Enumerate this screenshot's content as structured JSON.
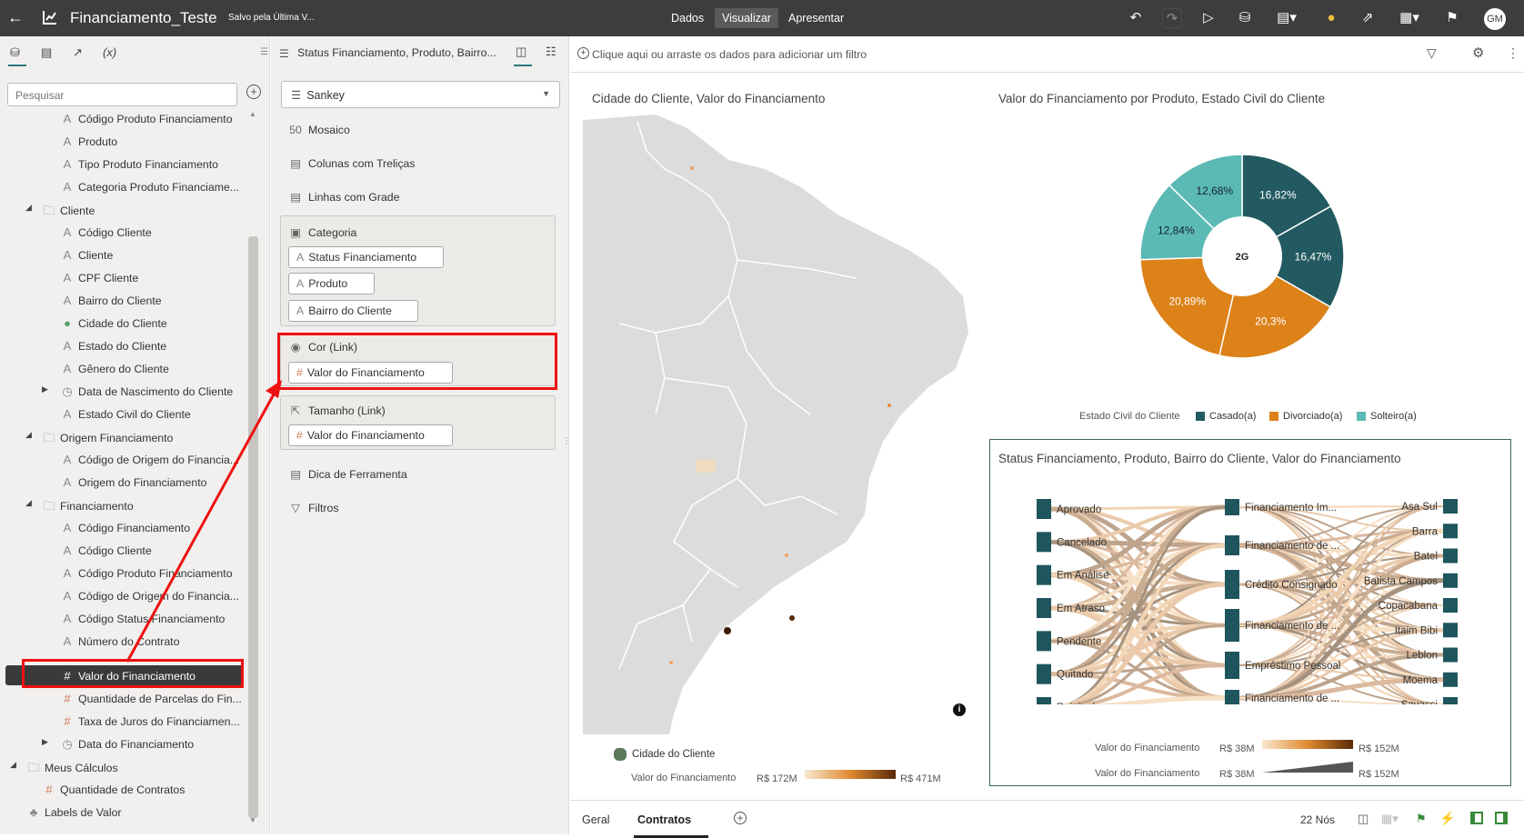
{
  "header": {
    "back_icon": "arrow-left-icon",
    "title": "Financiamento_Teste",
    "saved_status": "Salvo pela Última V...",
    "tabs": [
      "Dados",
      "Visualizar",
      "Apresentar"
    ],
    "active_tab": "Visualizar",
    "avatar_initials": "GM"
  },
  "left_panel": {
    "tabs": [
      "data-icon",
      "chart-icon",
      "analytics-icon",
      "(x)"
    ],
    "search_placeholder": "Pesquisar",
    "tree": [
      {
        "label": "Código Produto Financiamento",
        "type": "attr"
      },
      {
        "label": "Produto",
        "type": "attr"
      },
      {
        "label": "Tipo Produto Financiamento",
        "type": "attr"
      },
      {
        "label": "Categoria Produto Financiame...",
        "type": "attr"
      },
      {
        "label": "Cliente",
        "type": "folder"
      },
      {
        "label": "Código Cliente",
        "type": "attr"
      },
      {
        "label": "Cliente",
        "type": "attr"
      },
      {
        "label": "CPF Cliente",
        "type": "attr"
      },
      {
        "label": "Bairro do Cliente",
        "type": "attr"
      },
      {
        "label": "Cidade do Cliente",
        "type": "geo"
      },
      {
        "label": "Estado do Cliente",
        "type": "attr"
      },
      {
        "label": "Gênero do Cliente",
        "type": "attr"
      },
      {
        "label": "Data de Nascimento do Cliente",
        "type": "time"
      },
      {
        "label": "Estado Civil do Cliente",
        "type": "attr"
      },
      {
        "label": "Origem Financiamento",
        "type": "folder"
      },
      {
        "label": "Código de Origem do Financia...",
        "type": "attr"
      },
      {
        "label": "Origem do Financiamento",
        "type": "attr"
      },
      {
        "label": "Financiamento",
        "type": "folder"
      },
      {
        "label": "Código Financiamento",
        "type": "attr"
      },
      {
        "label": "Código Cliente",
        "type": "attr"
      },
      {
        "label": "Código Produto Financiamento",
        "type": "attr"
      },
      {
        "label": "Código de Origem do Financia...",
        "type": "attr"
      },
      {
        "label": "Código Status Financiamento",
        "type": "attr"
      },
      {
        "label": "Número do Contrato",
        "type": "attr"
      },
      {
        "label": "Valor do Financiamento",
        "type": "num"
      },
      {
        "label": "Quantidade de Parcelas do Fin...",
        "type": "num"
      },
      {
        "label": "Taxa de Juros do Financiamen...",
        "type": "num"
      },
      {
        "label": "Data do Financiamento",
        "type": "time"
      },
      {
        "label": "Meus Cálculos",
        "type": "folder"
      },
      {
        "label": "Quantidade de Contratos",
        "type": "num"
      },
      {
        "label": "Labels de Valor",
        "type": "tag"
      }
    ]
  },
  "middle_panel": {
    "viz_title": "Status Financiamento, Produto, Bairro...",
    "viz_type": "Sankey",
    "sections": [
      "Mosaico",
      "Colunas com Treliças",
      "Linhas com Grade"
    ],
    "categoria_label": "Categoria",
    "categoria_items": [
      "Status Financiamento",
      "Produto",
      "Bairro do Cliente"
    ],
    "cor_label": "Cor (Link)",
    "cor_item": "Valor do Financiamento",
    "tamanho_label": "Tamanho (Link)",
    "tamanho_item": "Valor do Financiamento",
    "dica_label": "Dica de Ferramenta",
    "filtros_label": "Filtros"
  },
  "filter_bar": {
    "text": "Clique aqui ou arraste os dados para adicionar um filtro"
  },
  "map_viz": {
    "title": "Cidade do Cliente, Valor do Financiamento",
    "legend_series": "Cidade do Cliente",
    "legend_measure": "Valor do Financiamento",
    "legend_min": "R$ 172M",
    "legend_max": "R$ 471M"
  },
  "donut_viz": {
    "title": "Valor do Financiamento por Produto, Estado Civil do Cliente",
    "center_label": "2G",
    "legend_title": "Estado Civil do Cliente",
    "legend": [
      {
        "name": "Casado(a)",
        "color": "#235a62"
      },
      {
        "name": "Divorciado(a)",
        "color": "#dc8219"
      },
      {
        "name": "Solteiro(a)",
        "color": "#5cbab5"
      }
    ]
  },
  "chart_data": {
    "type": "pie",
    "title": "Valor do Financiamento por Produto, Estado Civil do Cliente",
    "categories": [
      "Casado(a)",
      "Casado(a)",
      "Divorciado(a)",
      "Divorciado(a)",
      "Solteiro(a)",
      "Solteiro(a)"
    ],
    "values": [
      16.82,
      16.47,
      20.3,
      20.89,
      12.84,
      12.68
    ],
    "labels": [
      "16,82%",
      "16,47%",
      "20,3%",
      "20,89%",
      "12,84%",
      "12,68%"
    ],
    "colors": [
      "#235a62",
      "#235a62",
      "#dc8219",
      "#dc8219",
      "#5cbab5",
      "#5cbab5"
    ]
  },
  "sankey_viz": {
    "title": "Status Financiamento, Produto, Bairro do Cliente, Valor do Financiamento",
    "col1": [
      "Aprovado",
      "Cancelado",
      "Em Análise",
      "Em Atraso",
      "Pendente",
      "Quitado",
      "Rejeitado"
    ],
    "col2": [
      "Financiamento Im...",
      "Financiamento de ...",
      "Crédito Consignado",
      "Financiamento de ...",
      "Empréstimo Pessoal",
      "Financiamento de ..."
    ],
    "col3": [
      "Asa Sul",
      "Barra",
      "Batel",
      "Batista Campos",
      "Copacabana",
      "Itaim Bibi",
      "Leblon",
      "Moema",
      "Savassi"
    ],
    "legend_measure": "Valor do Financiamento",
    "color_min": "R$ 38M",
    "color_max": "R$ 152M",
    "size_min": "R$ 38M",
    "size_max": "R$ 152M"
  },
  "bottom_bar": {
    "tabs": [
      "Geral",
      "Contratos"
    ],
    "active_tab": "Contratos",
    "node_count": "22 Nós"
  }
}
